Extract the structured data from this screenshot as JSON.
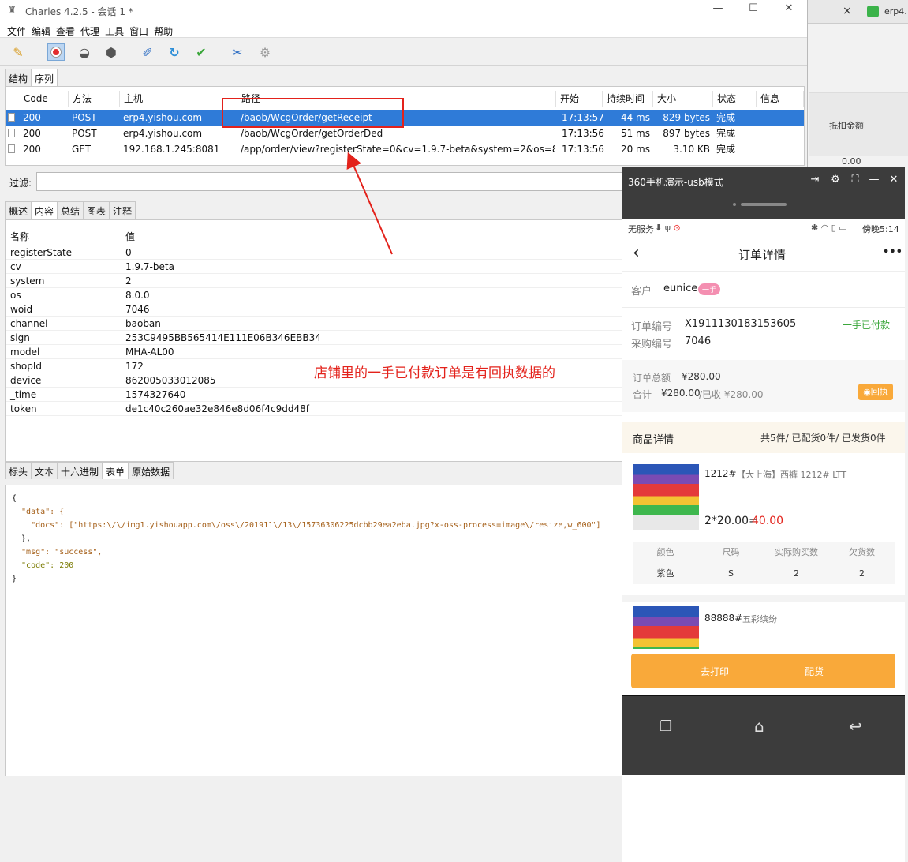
{
  "background_browser": {
    "tab_close": "×",
    "tab_label": "erp4.",
    "column_header": "抵扣金额",
    "column_value": "0.00"
  },
  "charles": {
    "title": "Charles 4.2.5 - 会话 1 *",
    "menu": [
      "文件",
      "编辑",
      "查看",
      "代理",
      "工具",
      "窗口",
      "帮助"
    ],
    "top_tabs": [
      "结构",
      "序列"
    ],
    "columns": [
      "Code",
      "方法",
      "主机",
      "路径",
      "开始",
      "持续时间",
      "大小",
      "状态",
      "信息"
    ],
    "requests": [
      {
        "code": "200",
        "method": "POST",
        "host": "erp4.yishou.com",
        "path": "/baob/WcgOrder/getReceipt",
        "start": "17:13:57",
        "duration": "44 ms",
        "size": "829 bytes",
        "status": "完成",
        "info": ""
      },
      {
        "code": "200",
        "method": "POST",
        "host": "erp4.yishou.com",
        "path": "/baob/WcgOrder/getOrderDed",
        "start": "17:13:56",
        "duration": "51 ms",
        "size": "897 bytes",
        "status": "完成",
        "info": ""
      },
      {
        "code": "200",
        "method": "GET",
        "host": "192.168.1.245:8081",
        "path": "/app/order/view?registerState=0&cv=1.9.7-beta&system=2&os=8...",
        "start": "17:13:56",
        "duration": "20 ms",
        "size": "3.10 KB",
        "status": "完成",
        "info": ""
      }
    ],
    "filter_label": "过滤:",
    "filter_value": "",
    "detail_tabs": [
      "概述",
      "内容",
      "总结",
      "图表",
      "注释"
    ],
    "param_headers": [
      "名称",
      "值"
    ],
    "params": [
      {
        "k": "registerState",
        "v": "0"
      },
      {
        "k": "cv",
        "v": "1.9.7-beta"
      },
      {
        "k": "system",
        "v": "2"
      },
      {
        "k": "os",
        "v": "8.0.0"
      },
      {
        "k": "woid",
        "v": "7046"
      },
      {
        "k": "channel",
        "v": "baoban"
      },
      {
        "k": "sign",
        "v": "253C9495BB565414E111E06B346EBB34"
      },
      {
        "k": "model",
        "v": "MHA-AL00"
      },
      {
        "k": "shopId",
        "v": "172"
      },
      {
        "k": "device",
        "v": "862005033012085"
      },
      {
        "k": "_time",
        "v": "1574327640"
      },
      {
        "k": "token",
        "v": "de1c40c260ae32e846e8d06f4c9dd48f"
      }
    ],
    "response_tabs": [
      "标头",
      "文本",
      "十六进制",
      "表单",
      "原始数据"
    ],
    "json_lines": [
      "{",
      "  \"data\": {",
      "    \"docs\": [\"https:\\/\\/img1.yishouapp.com\\/oss\\/201911\\/13\\/15736306225dcbb29ea2eba.jpg?x-oss-process=image\\/resize,w_600\"]",
      "  },",
      "  \"msg\": \"success\",",
      "  \"code\": 200",
      "}"
    ]
  },
  "annotation": {
    "note": "店铺里的一手已付款订单是有回执数据的"
  },
  "phone": {
    "window_title": "360手机演示-usb模式",
    "status_left": "无服务",
    "status_right": "傍晚5:14",
    "nav_title": "订单详情",
    "more": "•••",
    "customer_label": "客户",
    "customer_name": "eunice",
    "customer_tag": "一手",
    "order_no_label": "订单编号",
    "order_no": "X1911130183153605",
    "order_status": "一手已付款",
    "purchase_no_label": "采购编号",
    "purchase_no": "7046",
    "total_label": "订单总额",
    "total": "¥280.00",
    "sum_label": "合计",
    "sum_value": "¥280.00",
    "received": "/已收 ¥280.00",
    "receipt_button": "回执",
    "goods_title": "商品详情",
    "goods_summary": "共5件/ 已配货0件/ 已发货0件",
    "items": [
      {
        "name": "1212#",
        "desc": "【大上海】西裤 1212# LTT",
        "qty_price": "2*20.00=",
        "amount": "40.00"
      },
      {
        "name": "88888#",
        "desc": "五彩缤纷"
      }
    ],
    "spec_headers": [
      "颜色",
      "尺码",
      "实际购买数",
      "欠货数"
    ],
    "spec_values": [
      "紫色",
      "S",
      "2",
      "2"
    ],
    "btn_print": "去打印",
    "btn_dispatch": "配货"
  },
  "colors": {
    "selection": "#2f7bd8",
    "annotation_red": "#e3221b",
    "green_status": "#3aa63a",
    "orange": "#f9a93a"
  }
}
